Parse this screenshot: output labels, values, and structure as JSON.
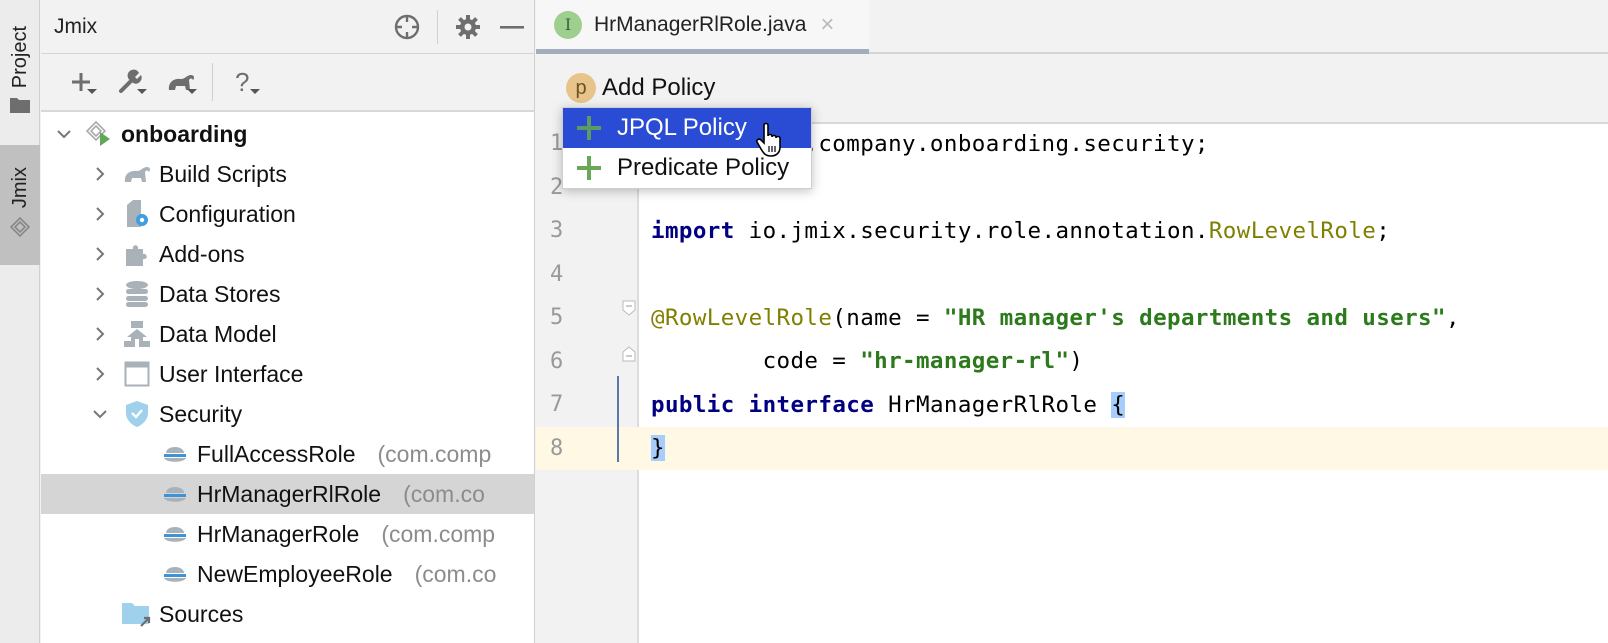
{
  "strip": {
    "tabs": [
      {
        "label": "Project",
        "icon": "folder-icon"
      },
      {
        "label": "Jmix",
        "icon": "jmix-icon"
      }
    ]
  },
  "panel": {
    "title": "Jmix",
    "header_buttons": [
      "locate-icon",
      "gear-icon",
      "minimize-icon"
    ],
    "toolbar_buttons": [
      "add-icon",
      "wrench-icon",
      "gradle-elephant-icon",
      "help-icon"
    ]
  },
  "tree": {
    "root": {
      "label": "onboarding",
      "expanded": true
    },
    "items": [
      {
        "label": "Build Scripts",
        "icon": "gradle-elephant-icon",
        "expanded": false
      },
      {
        "label": "Configuration",
        "icon": "configuration-icon",
        "expanded": false
      },
      {
        "label": "Add-ons",
        "icon": "puzzle-icon",
        "expanded": false
      },
      {
        "label": "Data Stores",
        "icon": "database-icon",
        "expanded": false
      },
      {
        "label": "Data Model",
        "icon": "data-model-icon",
        "expanded": false
      },
      {
        "label": "User Interface",
        "icon": "window-icon",
        "expanded": false
      },
      {
        "label": "Security",
        "icon": "shield-icon",
        "expanded": true
      }
    ],
    "roles": [
      {
        "label": "FullAccessRole",
        "package": "(com.comp",
        "selected": false
      },
      {
        "label": "HrManagerRlRole",
        "package": "(com.co",
        "selected": true
      },
      {
        "label": "HrManagerRole",
        "package": "(com.comp",
        "selected": false
      },
      {
        "label": "NewEmployeeRole",
        "package": "(com.co",
        "selected": false
      }
    ],
    "sources": {
      "label": "Sources",
      "icon": "source-folder-icon"
    }
  },
  "editor": {
    "tab": {
      "badge": "I",
      "label": "HrManagerRlRole.java",
      "close": "×"
    },
    "breadcrumb": {
      "badge": "p",
      "label": "Add Policy"
    },
    "popup": {
      "items": [
        {
          "label": "JPQL Policy",
          "active": true
        },
        {
          "label": "Predicate Policy",
          "active": false
        }
      ]
    },
    "lines": [
      {
        "n": "1",
        "parts": [
          {
            "t": "package com.company.onboarding.security;",
            "c": "plain"
          }
        ]
      },
      {
        "n": "2",
        "parts": []
      },
      {
        "n": "3",
        "parts": [
          {
            "t": "import",
            "c": "kw"
          },
          {
            "t": " io.jmix.security.role.annotation.",
            "c": "plain"
          },
          {
            "t": "RowLevelRole",
            "c": "ann"
          },
          {
            "t": ";",
            "c": "plain"
          }
        ]
      },
      {
        "n": "4",
        "parts": []
      },
      {
        "n": "5",
        "parts": [
          {
            "t": "@RowLevelRole",
            "c": "ann"
          },
          {
            "t": "(name = ",
            "c": "plain"
          },
          {
            "t": "\"HR manager's departments and users\"",
            "c": "str"
          },
          {
            "t": ",",
            "c": "plain"
          }
        ]
      },
      {
        "n": "6",
        "parts": [
          {
            "t": "        code = ",
            "c": "plain"
          },
          {
            "t": "\"hr-manager-rl\"",
            "c": "str"
          },
          {
            "t": ")",
            "c": "plain"
          }
        ]
      },
      {
        "n": "7",
        "parts": [
          {
            "t": "public",
            "c": "kw"
          },
          {
            "t": " ",
            "c": "plain"
          },
          {
            "t": "interface",
            "c": "kw"
          },
          {
            "t": " HrManagerRlRole ",
            "c": "plain"
          },
          {
            "t": "{",
            "c": "brace"
          }
        ]
      },
      {
        "n": "8",
        "parts": [
          {
            "t": "}",
            "c": "brace"
          }
        ],
        "current": true
      }
    ]
  }
}
